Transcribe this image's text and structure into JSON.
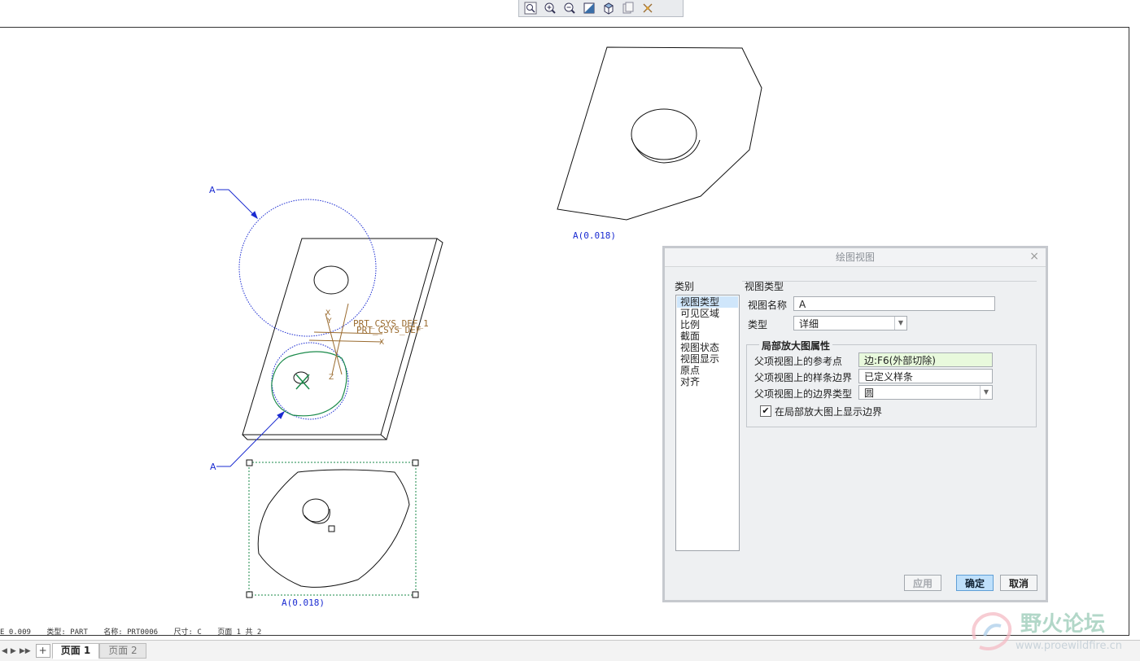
{
  "toolbar": {
    "icons": [
      "zoom-fit-icon",
      "zoom-in-icon",
      "zoom-out-icon",
      "repaint-icon",
      "display-style-icon",
      "saved-views-icon",
      "datum-display-icon"
    ]
  },
  "drawing": {
    "views": [
      {
        "label": "A(0.018)"
      },
      {
        "label": "A(0.018)"
      }
    ],
    "callout_letter_1": "A",
    "callout_letter_2": "A",
    "csys_label_1": "PRT_CSYS_DEF_1",
    "csys_label_2": "PRT_CSYS_DEF",
    "axis_x": "X",
    "axis_y": "Y",
    "axis_z": "Z"
  },
  "status": {
    "scale": "E 0.009",
    "type": "类型: PART",
    "name": "名称: PRT0006",
    "size": "尺寸: C",
    "page": "页面 1 共 2"
  },
  "tabs": {
    "add": "+",
    "page1": "页面 1",
    "page2": "页面 2"
  },
  "dialog": {
    "title": "绘图视图",
    "close": "×",
    "category_label": "类别",
    "categories": [
      "视图类型",
      "可见区域",
      "比例",
      "截面",
      "视图状态",
      "视图显示",
      "原点",
      "对齐"
    ],
    "selected_category": "视图类型",
    "section_title": "视图类型",
    "view_name_label": "视图名称",
    "view_name_value": "A",
    "type_label": "类型",
    "type_value": "详细",
    "group_title": "局部放大图属性",
    "ref_point_label": "父项视图上的参考点",
    "ref_point_value": "边:F6(外部切除)",
    "spline_label": "父项视图上的样条边界",
    "spline_value": "已定义样条",
    "boundary_type_label": "父项视图上的边界类型",
    "boundary_type_value": "圆",
    "show_boundary_label": "在局部放大图上显示边界",
    "show_boundary_checked": true,
    "apply": "应用",
    "ok": "确定",
    "cancel": "取消"
  },
  "watermark": {
    "brand": "野火论坛",
    "url": "www.proewildfire.cn"
  }
}
